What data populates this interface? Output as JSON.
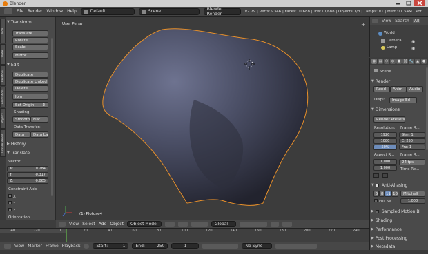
{
  "window": {
    "title": "Blender"
  },
  "menubar": {
    "items": [
      "File",
      "Render",
      "Window",
      "Help"
    ],
    "layout": "Default",
    "scene": "Scene",
    "engine": "Blender Render",
    "stats": "v2.79 | Verts:5,346 | Faces:10,688 | Tris:10,688 | Objects:1/3 | Lamps:0/1 | Mem:11.54M | Pot"
  },
  "shelf": {
    "transform_header": "Transform",
    "transform_buttons": [
      "Translate",
      "Rotate",
      "Scale",
      "Mirror"
    ],
    "edit_header": "Edit",
    "edit_buttons": [
      "Duplicate",
      "Duplicate Linked",
      "Delete",
      "Join",
      "Set Origin"
    ],
    "shading_label": "Shading:",
    "shading_buttons": [
      "Smooth",
      "Flat"
    ],
    "data_transfer_label": "Data Transfer:",
    "data_transfer_buttons": [
      "Data",
      "Data La"
    ],
    "history_header": "History",
    "translate_header": "Translate",
    "vector_label": "Vector",
    "vector": [
      {
        "axis": "X:",
        "value": "0.284"
      },
      {
        "axis": "Y:",
        "value": "-0.317"
      },
      {
        "axis": "Z:",
        "value": "-0.065"
      }
    ],
    "constraint_label": "Constraint Axis",
    "constraint_axes": [
      "X",
      "Y",
      "Z"
    ],
    "orientation_label": "Orientation",
    "tabs": [
      "Tools",
      "Create",
      "Relations",
      "Animation",
      "Physics",
      "Grease Pencil"
    ]
  },
  "viewport": {
    "view_label": "User Persp",
    "object_label": "(1) Plotose4"
  },
  "view3d_header": {
    "menus": [
      "View",
      "Select",
      "Add",
      "Object"
    ],
    "mode": "Object Mode",
    "orientation": "Global"
  },
  "timeline": {
    "ticks": [
      "-40",
      "-20",
      "0",
      "20",
      "40",
      "60",
      "80",
      "100",
      "120",
      "140",
      "160",
      "180",
      "200",
      "220",
      "240",
      "260"
    ],
    "menus": [
      "View",
      "Marker",
      "Frame",
      "Playback"
    ],
    "start_label": "Start:",
    "start_value": "1",
    "end_label": "End:",
    "end_value": "250",
    "current_frame": "1",
    "sync": "No Sync"
  },
  "outliner": {
    "menus": [
      "View",
      "Search",
      "All"
    ],
    "items": [
      "World",
      "Camera",
      "Lamp"
    ]
  },
  "properties": {
    "scene_label": "Scene",
    "render_header": "Render",
    "render_buttons": [
      "Rend",
      "Anim",
      "Audio"
    ],
    "display_label": "Displ:",
    "display_value": "Image Ed",
    "dimensions_header": "Dimensions",
    "render_presets": "Render Presets",
    "resolution_label": "Resolution:",
    "frame_range_label": "Frame R...",
    "resolution_x": "1920",
    "resolution_y": "1080",
    "resolution_pct": "50%",
    "frame_start": "Star: 1",
    "frame_end": "E: 250",
    "frame_step": "Fra: 1",
    "aspect_label": "Aspect R...",
    "frame_rate_label": "Frame R...",
    "aspect_x": "1.000",
    "aspect_y": "1.000",
    "fps": "24 fps",
    "time_remap_label": "Time Re...",
    "aa_header": "Anti-Aliasing",
    "aa_samples": [
      "5",
      "8",
      "11",
      "16"
    ],
    "aa_filter": "Mitchell",
    "full_sample": "Full Sa",
    "filter_size": "1.000",
    "collapsed_sections": [
      "Sampled Motion Bl",
      "Shading",
      "Performance",
      "Post Processing",
      "Metadata"
    ]
  }
}
